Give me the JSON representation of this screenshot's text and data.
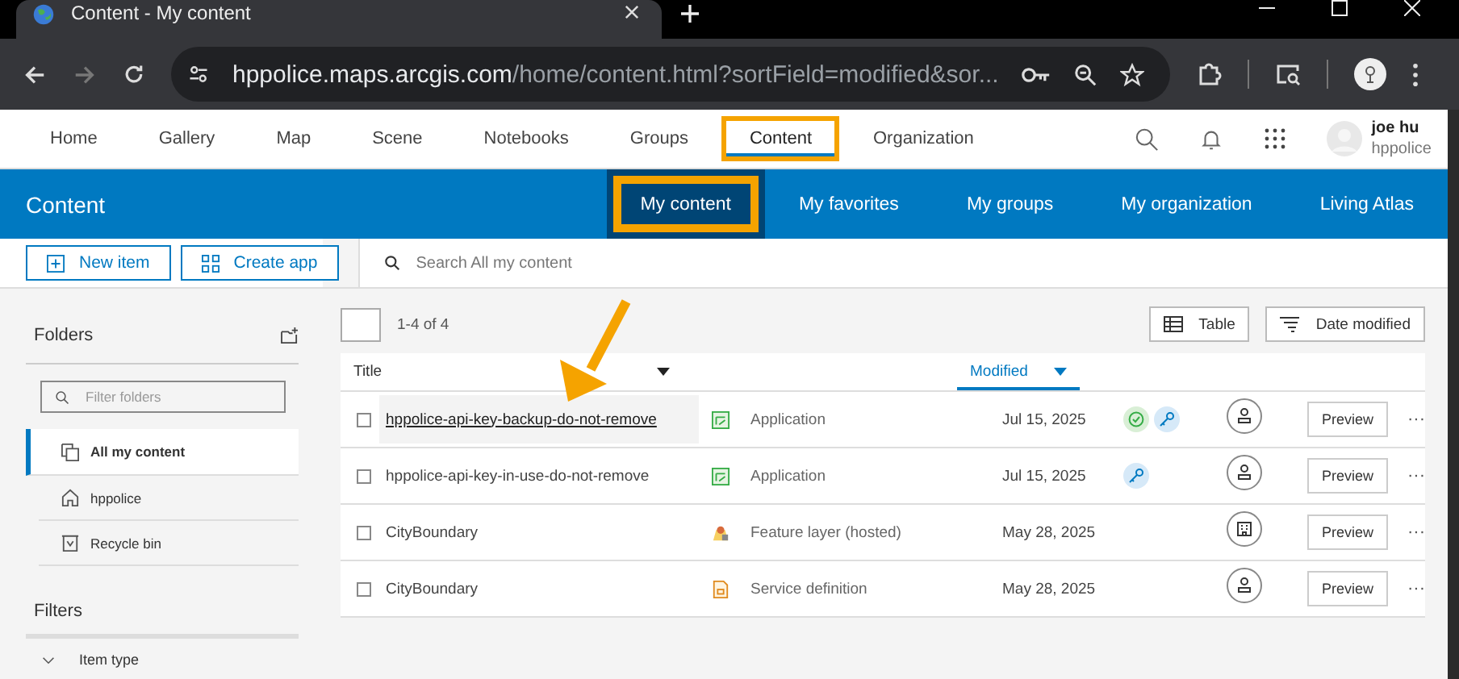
{
  "browser": {
    "tab_title": "Content - My content",
    "url_host": "hppolice.maps.arcgis.com",
    "url_path": "/home/content.html?sortField=modified&sor..."
  },
  "nav": {
    "items": [
      {
        "label": "Home",
        "selected": false,
        "highlighted": false
      },
      {
        "label": "Gallery",
        "selected": false,
        "highlighted": false
      },
      {
        "label": "Map",
        "selected": false,
        "highlighted": false
      },
      {
        "label": "Scene",
        "selected": false,
        "highlighted": false
      },
      {
        "label": "Notebooks",
        "selected": false,
        "highlighted": false
      },
      {
        "label": "Groups",
        "selected": false,
        "highlighted": false
      },
      {
        "label": "Content",
        "selected": true,
        "highlighted": true
      },
      {
        "label": "Organization",
        "selected": false,
        "highlighted": false
      }
    ],
    "user_name": "joe hu",
    "user_org": "hppolice"
  },
  "content_bar": {
    "title": "Content",
    "tabs": [
      {
        "label": "My content",
        "selected": true,
        "highlighted": true
      },
      {
        "label": "My favorites",
        "selected": false,
        "highlighted": false
      },
      {
        "label": "My groups",
        "selected": false,
        "highlighted": false
      },
      {
        "label": "My organization",
        "selected": false,
        "highlighted": false
      },
      {
        "label": "Living Atlas",
        "selected": false,
        "highlighted": false
      }
    ]
  },
  "toolbar": {
    "new_item": "New item",
    "create_app": "Create app",
    "search_placeholder": "Search All my content"
  },
  "sidebar": {
    "folders_title": "Folders",
    "filter_placeholder": "Filter folders",
    "folders": [
      {
        "label": "All my content",
        "kind": "all",
        "selected": true
      },
      {
        "label": "hppolice",
        "kind": "home",
        "selected": false
      },
      {
        "label": "Recycle bin",
        "kind": "bin",
        "selected": false
      }
    ],
    "filters_title": "Filters",
    "filters": [
      {
        "label": "Item type",
        "expanded": false
      }
    ]
  },
  "table": {
    "select_all_checked": false,
    "count": "1-4 of 4",
    "view_button": "Table",
    "sort_button": "Date modified",
    "columns": [
      {
        "label": "Title",
        "sorted": false
      },
      {
        "label": "Modified",
        "sorted": true
      }
    ],
    "rows": [
      {
        "title": "hppolice-api-key-backup-do-not-remove",
        "hovered": true,
        "checked": false,
        "type_icon": {
          "kind": "app"
        },
        "type": "Application",
        "modified": "Jul 15, 2025",
        "badges": [
          {
            "kind": "check"
          },
          {
            "kind": "key"
          }
        ],
        "share_icon": {
          "kind": "user"
        },
        "preview": "Preview",
        "more": "···"
      },
      {
        "title": "hppolice-api-key-in-use-do-not-remove",
        "hovered": false,
        "checked": false,
        "type_icon": {
          "kind": "app"
        },
        "type": "Application",
        "modified": "Jul 15, 2025",
        "badges": [
          {
            "kind": "key"
          }
        ],
        "share_icon": {
          "kind": "user"
        },
        "preview": "Preview",
        "more": "···"
      },
      {
        "title": "CityBoundary",
        "hovered": false,
        "checked": false,
        "type_icon": {
          "kind": "feature"
        },
        "type": "Feature layer (hosted)",
        "modified": "May 28, 2025",
        "badges": [],
        "share_icon": {
          "kind": "org"
        },
        "preview": "Preview",
        "more": "···"
      },
      {
        "title": "CityBoundary",
        "hovered": false,
        "checked": false,
        "type_icon": {
          "kind": "service"
        },
        "type": "Service definition",
        "modified": "May 28, 2025",
        "badges": [],
        "share_icon": {
          "kind": "user"
        },
        "preview": "Preview",
        "more": "···"
      }
    ]
  }
}
